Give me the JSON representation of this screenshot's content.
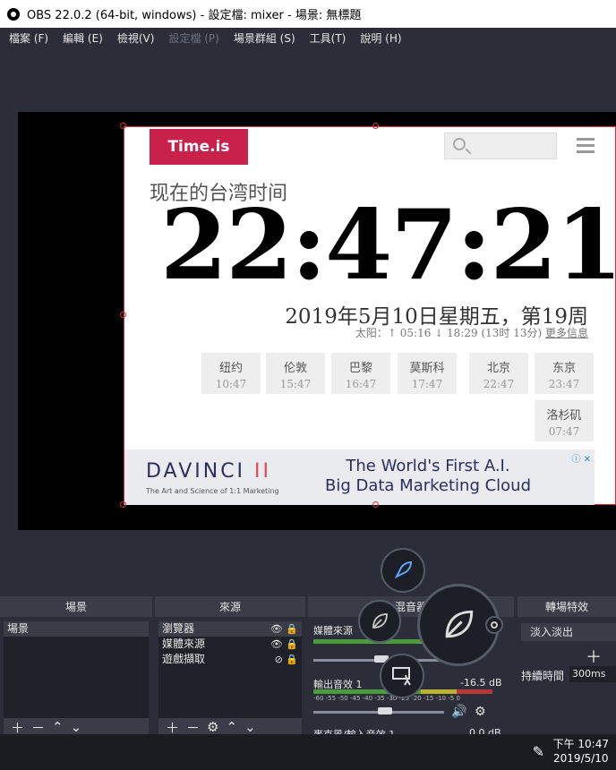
{
  "window": {
    "title": "OBS 22.0.2 (64-bit, windows) - 設定檔: mixer - 場景: 無標題"
  },
  "menu": {
    "items": [
      "檔案 (F)",
      "編輯 (E)",
      "檢視(V)",
      "設定檔 (P)",
      "場景群組 (S)",
      "工具(T)",
      "說明 (H)"
    ]
  },
  "browser": {
    "logo": "Time.is",
    "timezone_label": "现在的台湾时间",
    "time": "22:47:21",
    "date": "2019年5月10日星期五，第19周",
    "sun_info": "太阳：↑ 05:16 ↓ 18:29 (13时 13分)",
    "sun_more": "更多信息",
    "cities": [
      {
        "name": "纽约",
        "time": "10:47"
      },
      {
        "name": "伦敦",
        "time": "15:47"
      },
      {
        "name": "巴黎",
        "time": "16:47"
      },
      {
        "name": "莫斯科",
        "time": "17:47"
      },
      {
        "name": "北京",
        "time": "22:47"
      },
      {
        "name": "东京",
        "time": "23:47"
      },
      {
        "name": "洛杉矶",
        "time": "07:47"
      }
    ],
    "ad": {
      "brand_a": "DAVINCI",
      "brand_b": "II",
      "sub": "The Art and Science of 1:1 Marketing",
      "headline_1": "The World's First A.I.",
      "headline_2": "Big Data Marketing Cloud",
      "close": "ⓘ ✕"
    }
  },
  "docks": {
    "scenes": {
      "title": "場景",
      "items": [
        "場景"
      ]
    },
    "sources": {
      "title": "來源",
      "items": [
        "瀏覽器",
        "媒體來源",
        "遊戲擷取"
      ]
    },
    "mixer": {
      "title": "混音器",
      "channels": [
        {
          "name": "媒體來源",
          "db": ""
        },
        {
          "name": "輸出音效 1",
          "db": "-16.5 dB"
        },
        {
          "name": "麥克風/輸入音效 1",
          "db": "0.0 dB"
        }
      ],
      "scale": "-60 -55 -50 -45 -40 -35 -30 -25 -20 -15 -10 -5 0"
    },
    "transitions": {
      "title": "轉場特效",
      "selected": "淡入淡出",
      "duration_label": "持續時間",
      "duration_value": "300ms"
    }
  },
  "taskbar": {
    "time": "下午 10:47",
    "date": "2019/5/10"
  },
  "radial_icons": [
    "rocket-icon",
    "leaf-icon",
    "leaf-icon",
    "desktop-walk-icon",
    "gear-icon"
  ]
}
